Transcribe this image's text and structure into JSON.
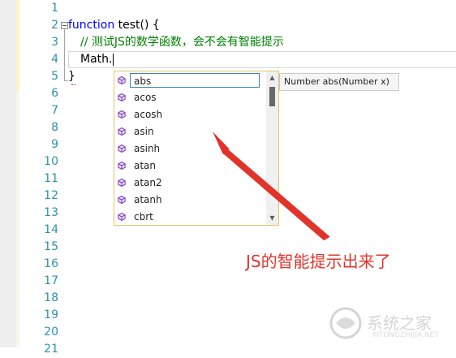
{
  "editor": {
    "line_numbers": [
      "1",
      "2",
      "3",
      "4",
      "5",
      "6",
      "7",
      "8",
      "9",
      "10",
      "11",
      "12",
      "13",
      "14",
      "15",
      "16",
      "17",
      "18",
      "19",
      "20",
      "21"
    ],
    "code": {
      "line2_keyword": "function",
      "line2_rest": " test() {",
      "line3_comment": "// 测试JS的数学函数，会不会有智能提示",
      "line4_text": "Math.",
      "line5_text": "}"
    }
  },
  "completion_list": {
    "items": [
      "abs",
      "acos",
      "acosh",
      "asin",
      "asinh",
      "atan",
      "atan2",
      "atanh",
      "cbrt"
    ],
    "selected": "abs",
    "item_icon": "method-cube-icon"
  },
  "tooltip": {
    "text": "Number abs(Number x)"
  },
  "annotation": {
    "text": "JS的智能提示出来了"
  },
  "watermark": {
    "text": "系统之家",
    "sub": "XITONGZHIJIA.NET"
  },
  "colors": {
    "keyword": "#0000ff",
    "comment": "#008000",
    "line_number": "#2b91af",
    "annotation": "#e0342a",
    "selection_border": "#3c7fb1",
    "list_border": "#e5c365",
    "method_icon": "#7b3fb6"
  }
}
